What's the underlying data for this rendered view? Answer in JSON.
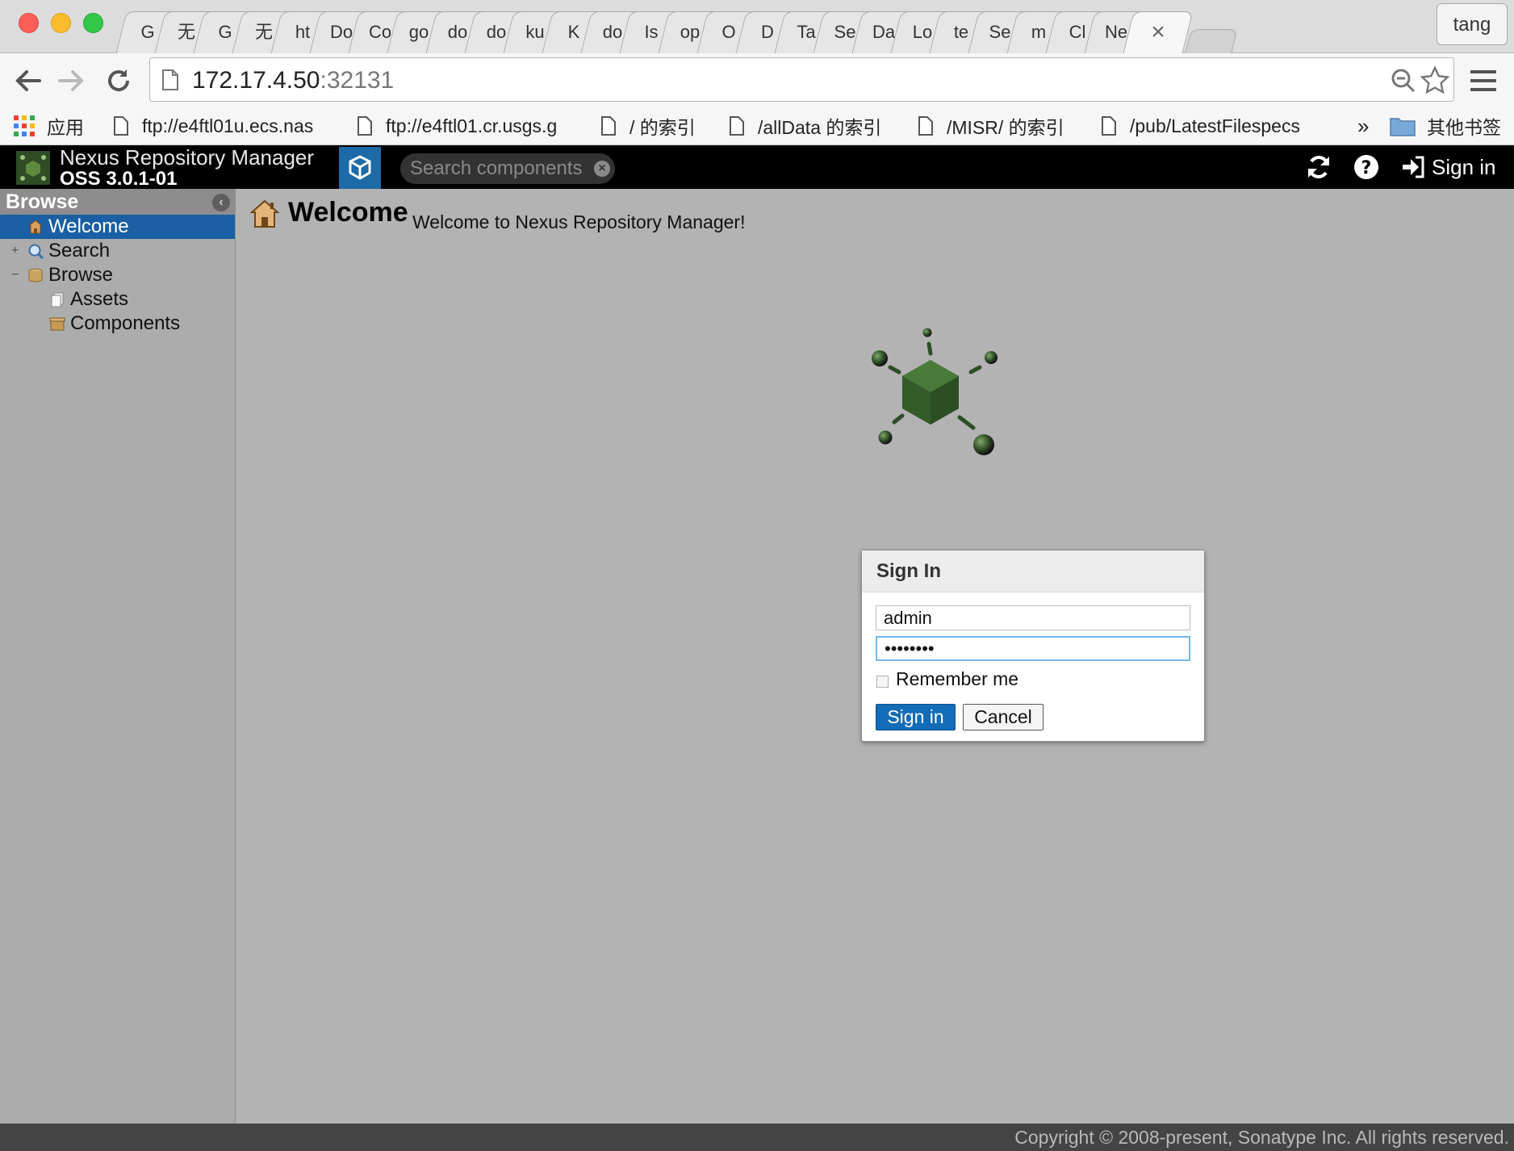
{
  "browser": {
    "tabs": [
      "G",
      "无",
      "G",
      "无",
      "ht",
      "Do",
      "Co",
      "go",
      "do",
      "do",
      "ku",
      "K",
      "do",
      "Is",
      "op",
      "O",
      "D",
      "Ta",
      "Se",
      "Da",
      "Lo",
      "te",
      "Se",
      "m",
      "Cl",
      "Ne"
    ],
    "active_tab_close": "×",
    "profile": "tang",
    "url_host": "172.17.4.50",
    "url_port": ":32131",
    "bookmarks": {
      "apps": "应用",
      "items": [
        "ftp://e4ftl01u.ecs.nas",
        "ftp://e4ftl01.cr.usgs.g",
        "/ 的索引",
        "/allData 的索引",
        "/MISR/ 的索引",
        "/pub/LatestFilespecs"
      ],
      "overflow": "»",
      "other": "其他书签"
    }
  },
  "app": {
    "name": "Nexus Repository Manager",
    "version": "OSS 3.0.1-01",
    "search_placeholder": "Search components",
    "signin_label": "Sign in"
  },
  "sidebar": {
    "title": "Browse",
    "items": [
      {
        "label": "Welcome",
        "expander": ""
      },
      {
        "label": "Search",
        "expander": "+"
      },
      {
        "label": "Browse",
        "expander": "−"
      },
      {
        "label": "Assets",
        "expander": ""
      },
      {
        "label": "Components",
        "expander": ""
      }
    ]
  },
  "main": {
    "title": "Welcome",
    "subtitle": "Welcome to Nexus Repository Manager!"
  },
  "dialog": {
    "title": "Sign In",
    "username_value": "admin",
    "password_value": "********",
    "remember_label": "Remember me",
    "remember_checked": false,
    "signin_button": "Sign in",
    "cancel_button": "Cancel"
  },
  "footer": {
    "copyright": "Copyright © 2008-present, Sonatype Inc. All rights reserved."
  },
  "colors": {
    "header_bg": "#000000",
    "selected_bg": "#1a5fa3",
    "primary_button": "#136cb7",
    "logo_green": "#3d6b2e"
  }
}
